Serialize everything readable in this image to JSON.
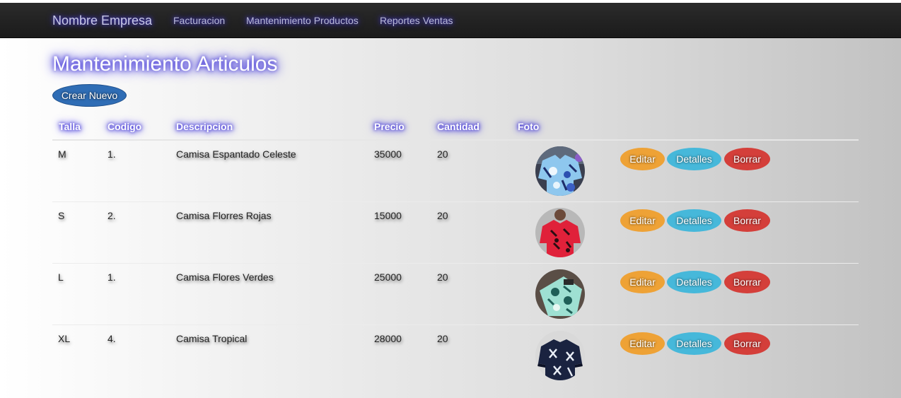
{
  "navbar": {
    "brand": "Nombre Empresa",
    "links": [
      "Facturacion",
      "Mantenimiento Productos",
      "Reportes Ventas"
    ]
  },
  "page": {
    "title": "Mantenimiento Articulos",
    "create_label": "Crear Nuevo"
  },
  "table": {
    "headers": [
      "Talla",
      "Codigo",
      "Descripcion",
      "Precio",
      "Cantidad",
      "Foto"
    ],
    "rows": [
      {
        "talla": "M",
        "codigo": "1.",
        "descripcion": "Camisa Espantado Celeste",
        "precio": "35000",
        "cantidad": "20",
        "foto": "light-blue-tropical-shirt-photo"
      },
      {
        "talla": "S",
        "codigo": "2.",
        "descripcion": "Camisa Florres Rojas",
        "precio": "15000",
        "cantidad": "20",
        "foto": "red-floral-shirt-photo"
      },
      {
        "talla": "L",
        "codigo": "1.",
        "descripcion": "Camisa Flores Verdes",
        "precio": "25000",
        "cantidad": "20",
        "foto": "green-floral-shirt-photo"
      },
      {
        "talla": "XL",
        "codigo": "4.",
        "descripcion": "Camisa Tropical",
        "precio": "28000",
        "cantidad": "20",
        "foto": "navy-palm-shirt-photo"
      }
    ],
    "actions": {
      "edit": "Editar",
      "details": "Detalles",
      "delete": "Borrar"
    }
  },
  "colors": {
    "navbar": "#222222",
    "glow": "#3b2fd6",
    "edit": "#eea236",
    "details": "#46b8da",
    "delete": "#d43f3a",
    "primary": "#2f6db5"
  }
}
